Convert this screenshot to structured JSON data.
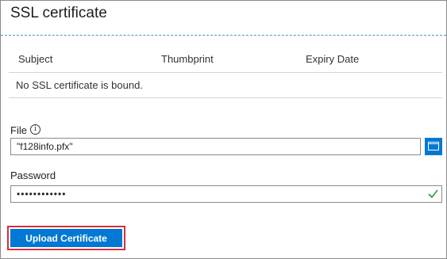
{
  "blade": {
    "title": "SSL certificate"
  },
  "table": {
    "columns": [
      "Subject",
      "Thumbprint",
      "Expiry Date"
    ],
    "empty_message": "No SSL certificate is bound."
  },
  "file": {
    "label": "File",
    "value": "\"f128info.pfx\"",
    "info_icon": "info-icon",
    "browse_icon": "folder-browse-icon"
  },
  "password": {
    "label": "Password",
    "value": "••••••••••••",
    "valid_icon": "checkmark-icon"
  },
  "actions": {
    "upload_label": "Upload Certificate"
  },
  "colors": {
    "accent": "#0078d4",
    "highlight_border": "#d32f3f",
    "valid": "#2e9e42",
    "divider": "#3aa0c4"
  }
}
